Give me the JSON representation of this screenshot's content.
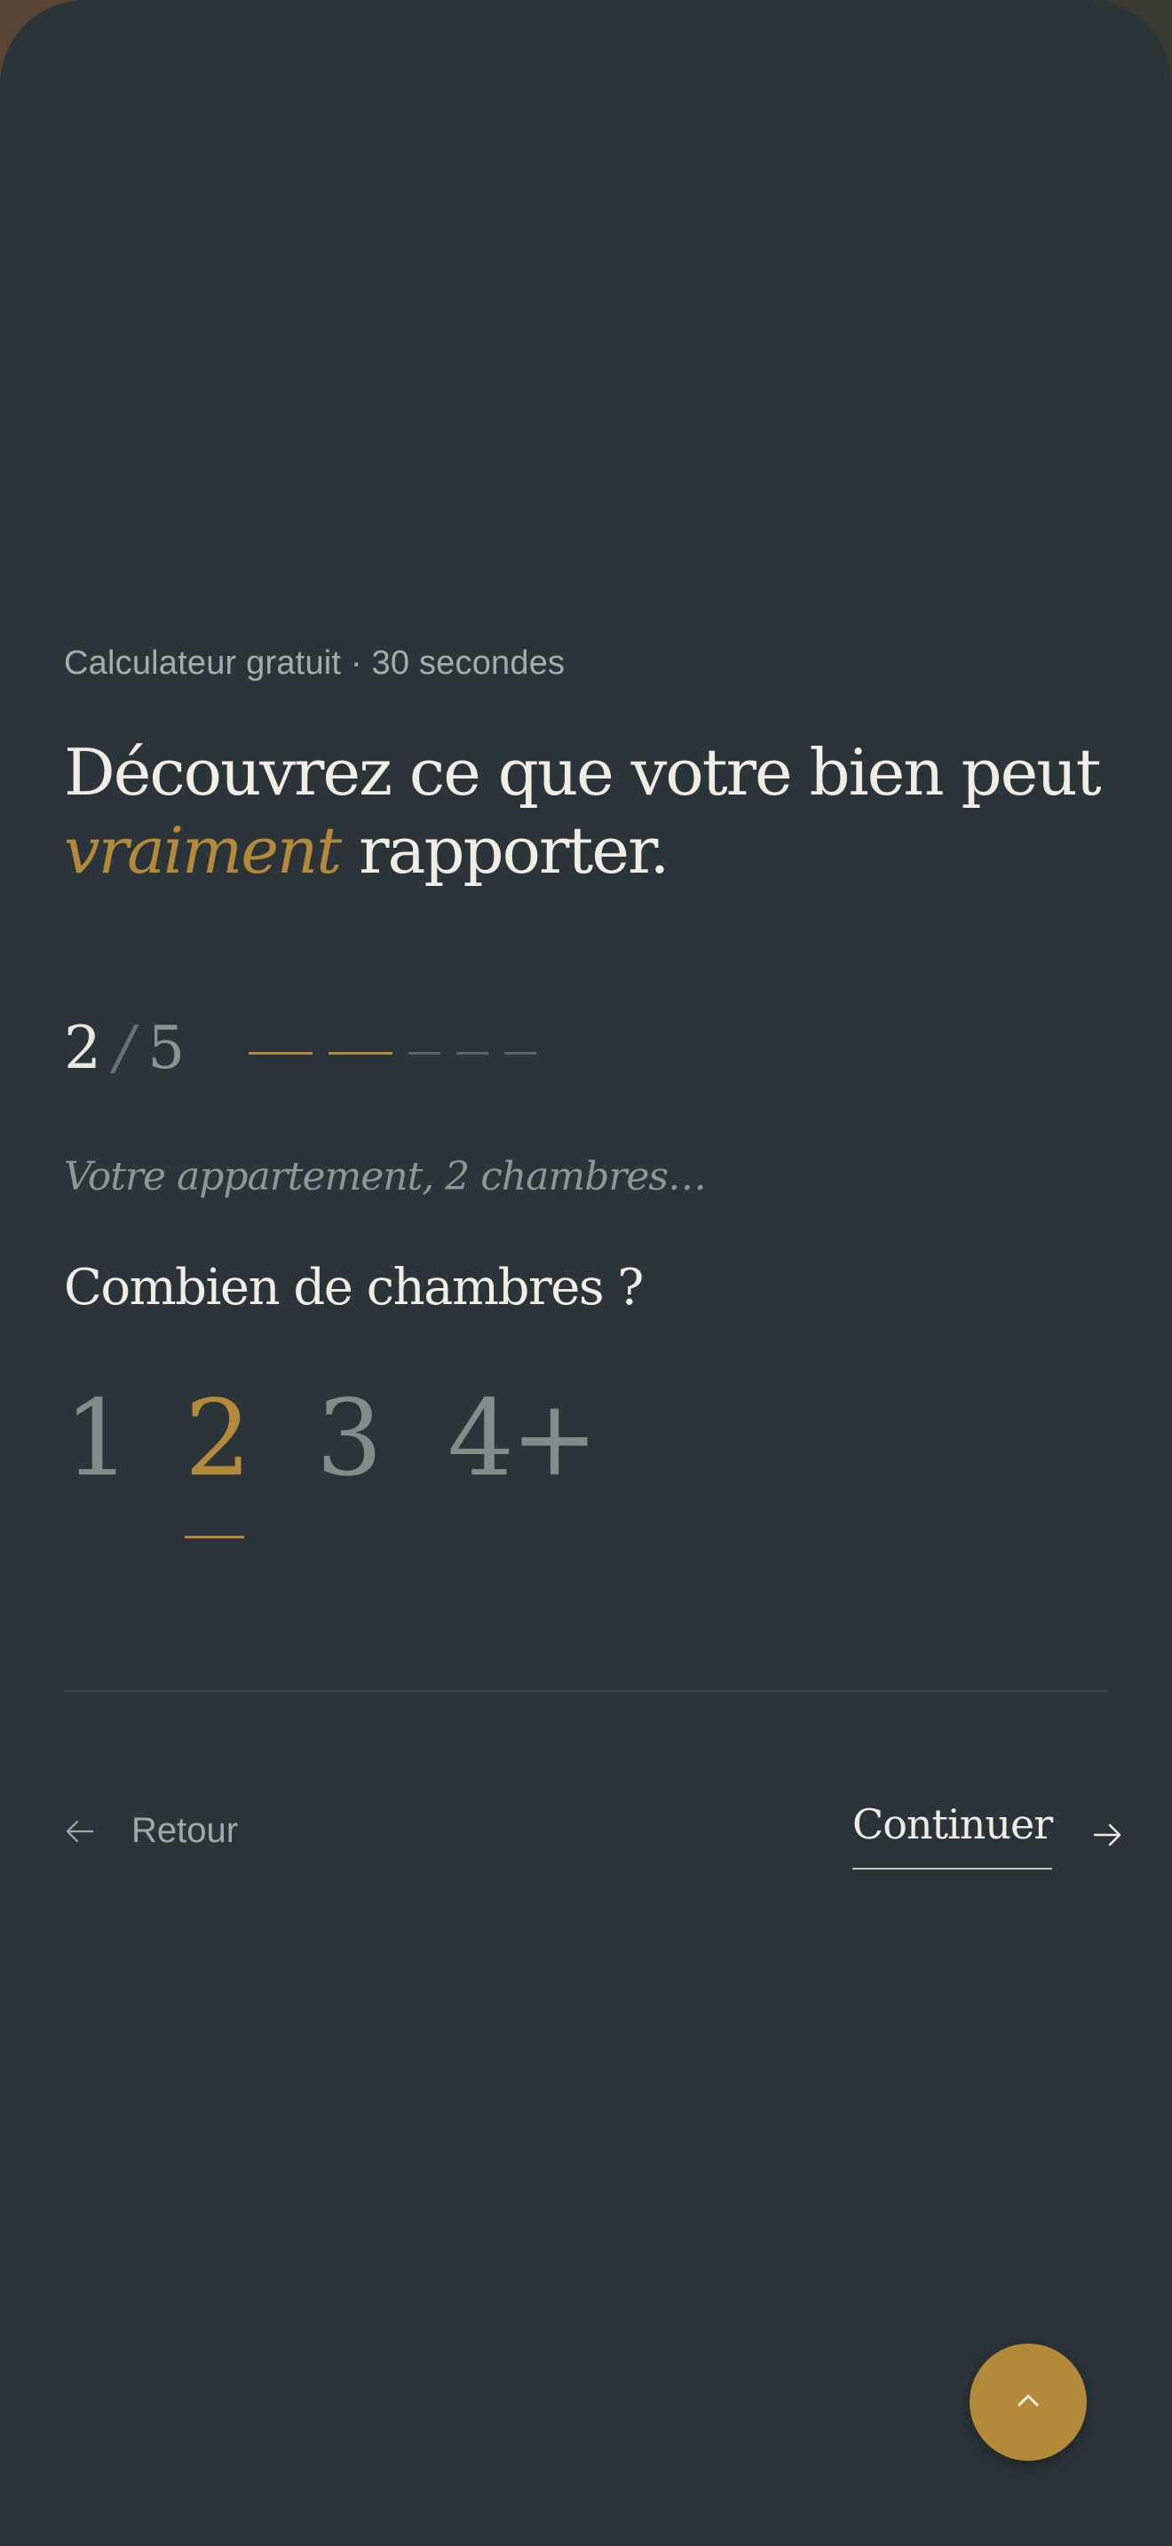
{
  "hero": {
    "eyebrow": "Calculateur gratuit · 30 secondes",
    "headline_line1": "Découvrez ce que votre bien peut",
    "headline_accent": "vraiment",
    "headline_rest": " rapporter."
  },
  "progress": {
    "current": "2",
    "separator": "/",
    "total": "5",
    "completed_steps": 2,
    "total_steps": 5
  },
  "step": {
    "recap": "Votre appartement, 2 chambres…",
    "question": "Combien de chambres ?",
    "options": [
      "1",
      "2",
      "3",
      "4+"
    ],
    "selected": "2"
  },
  "nav": {
    "back_label": "Retour",
    "continue_label": "Continuer"
  },
  "fab": {
    "icon": "chevron-up-icon"
  },
  "colors": {
    "background": "#2b3539",
    "accent": "#b48a3a",
    "text": "#f1ede4",
    "muted": "#858b8b"
  }
}
